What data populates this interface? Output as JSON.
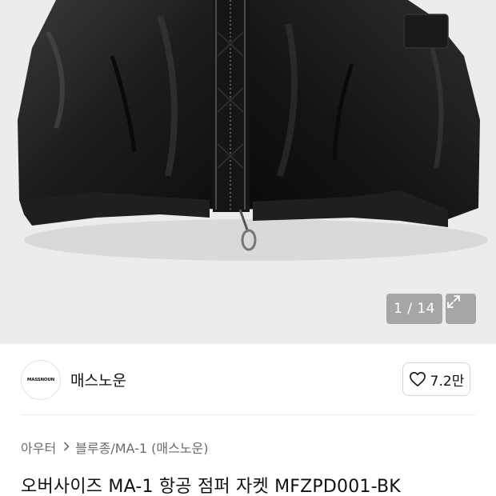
{
  "gallery": {
    "counter": "1 / 14",
    "current_page": 1,
    "total_pages": 14,
    "expand_icon": "expand-icon"
  },
  "brand": {
    "logo_text": "MASSNOUN",
    "name": "매스노운",
    "like_icon": "heart-outline-icon",
    "like_count": "7.2만"
  },
  "breadcrumb": {
    "items": [
      "아우터",
      "블루종/MA-1 (매스노운)"
    ],
    "separator_icon": "chevron-right-icon"
  },
  "product": {
    "title": "오버사이즈 MA-1 항공 점퍼 자켓 MFZPD001-BK"
  },
  "colors": {
    "gallery_bg": "#ececec",
    "text_primary": "#111111",
    "text_secondary": "#6b6b6b"
  }
}
